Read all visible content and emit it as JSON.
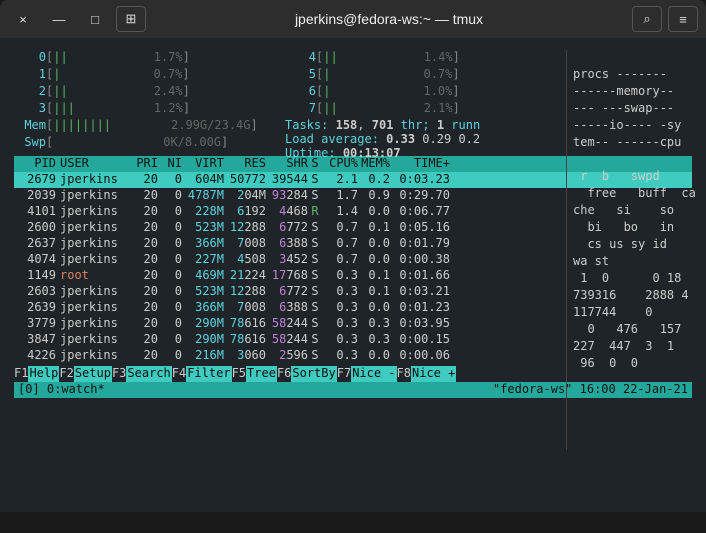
{
  "titlebar": {
    "close": "×",
    "minimize": "—",
    "maximize": "□",
    "new_tab": "⊞",
    "title": "jperkins@fedora-ws:~ — tmux",
    "search": "⌕",
    "menu": "≡"
  },
  "cpu_meters": [
    {
      "label": "0",
      "bars": "||",
      "val": "1.7%"
    },
    {
      "label": "1",
      "bars": "|",
      "val": "0.7%"
    },
    {
      "label": "2",
      "bars": "||",
      "val": "2.4%"
    },
    {
      "label": "3",
      "bars": "|||",
      "val": "1.2%"
    },
    {
      "label": "4",
      "bars": "||",
      "val": "1.4%"
    },
    {
      "label": "5",
      "bars": "|",
      "val": "0.7%"
    },
    {
      "label": "6",
      "bars": "|",
      "val": "1.0%"
    },
    {
      "label": "7",
      "bars": "||",
      "val": "2.1%"
    }
  ],
  "mem": {
    "label": "Mem",
    "bars": "||||||||",
    "val": "2.99G/23.4G"
  },
  "swp": {
    "label": "Swp",
    "bars": "",
    "val": "0K/8.00G"
  },
  "tasks": {
    "label": "Tasks:",
    "procs": "158",
    "sep": ",",
    "thr": "701",
    "thr_lbl": "thr;",
    "run": "1",
    "run_lbl": "runn"
  },
  "load": {
    "label": "Load average:",
    "v1": "0.33",
    "v2": "0.29",
    "v3": "0.2"
  },
  "uptime": {
    "label": "Uptime:",
    "val": "00:13:07"
  },
  "right_panel": [
    "",
    "procs -------",
    "------memory--",
    "--- ---swap---",
    "-----io---- -sy",
    "tem-- ------cpu",
    "",
    " r  b   swpd",
    "  free   buff  ca",
    "che   si    so",
    "  bi   bo   in",
    "  cs us sy id",
    "wa st",
    " 1  0      0 18",
    "739316    2888 4",
    "117744    0",
    "  0   476   157",
    "227  447  3  1",
    " 96  0  0"
  ],
  "proc_header": {
    "pid": "PID",
    "user": "USER",
    "pri": "PRI",
    "ni": "NI",
    "virt": "VIRT",
    "res": "RES",
    "shr": "SHR",
    "s": "S",
    "cpu": "CPU%",
    "mem": "MEM%",
    "time": "TIME+"
  },
  "procs": [
    {
      "pid": "2679",
      "user": "jperkins",
      "pri": "20",
      "ni": "0",
      "virt": "604M",
      "res": "50772",
      "shr": "39544",
      "s": "S",
      "cpu": "2.1",
      "mem": "0.2",
      "time": "0:03.23",
      "sel": true
    },
    {
      "pid": "2039",
      "user": "jperkins",
      "pri": "20",
      "ni": "0",
      "virt": "4787M",
      "res": "204M",
      "shr": "93284",
      "s": "S",
      "cpu": "1.7",
      "mem": "0.9",
      "time": "0:29.70"
    },
    {
      "pid": "4101",
      "user": "jperkins",
      "pri": "20",
      "ni": "0",
      "virt": "228M",
      "res": "6192",
      "shr": "4468",
      "s": "R",
      "cpu": "1.4",
      "mem": "0.0",
      "time": "0:06.77"
    },
    {
      "pid": "2600",
      "user": "jperkins",
      "pri": "20",
      "ni": "0",
      "virt": "523M",
      "res": "12288",
      "shr": "6772",
      "s": "S",
      "cpu": "0.7",
      "mem": "0.1",
      "time": "0:05.16"
    },
    {
      "pid": "2637",
      "user": "jperkins",
      "pri": "20",
      "ni": "0",
      "virt": "366M",
      "res": "7008",
      "shr": "6388",
      "s": "S",
      "cpu": "0.7",
      "mem": "0.0",
      "time": "0:01.79"
    },
    {
      "pid": "4074",
      "user": "jperkins",
      "pri": "20",
      "ni": "0",
      "virt": "227M",
      "res": "4508",
      "shr": "3452",
      "s": "S",
      "cpu": "0.7",
      "mem": "0.0",
      "time": "0:00.38"
    },
    {
      "pid": "1149",
      "user": "root",
      "pri": "20",
      "ni": "0",
      "virt": "469M",
      "res": "21224",
      "shr": "17768",
      "s": "S",
      "cpu": "0.3",
      "mem": "0.1",
      "time": "0:01.66",
      "root": true
    },
    {
      "pid": "2603",
      "user": "jperkins",
      "pri": "20",
      "ni": "0",
      "virt": "523M",
      "res": "12288",
      "shr": "6772",
      "s": "S",
      "cpu": "0.3",
      "mem": "0.1",
      "time": "0:03.21"
    },
    {
      "pid": "2639",
      "user": "jperkins",
      "pri": "20",
      "ni": "0",
      "virt": "366M",
      "res": "7008",
      "shr": "6388",
      "s": "S",
      "cpu": "0.3",
      "mem": "0.0",
      "time": "0:01.23"
    },
    {
      "pid": "3779",
      "user": "jperkins",
      "pri": "20",
      "ni": "0",
      "virt": "290M",
      "res": "78616",
      "shr": "58244",
      "s": "S",
      "cpu": "0.3",
      "mem": "0.3",
      "time": "0:03.95"
    },
    {
      "pid": "3847",
      "user": "jperkins",
      "pri": "20",
      "ni": "0",
      "virt": "290M",
      "res": "78616",
      "shr": "58244",
      "s": "S",
      "cpu": "0.3",
      "mem": "0.3",
      "time": "0:00.15"
    },
    {
      "pid": "4226",
      "user": "jperkins",
      "pri": "20",
      "ni": "0",
      "virt": "216M",
      "res": "3060",
      "shr": "2596",
      "s": "S",
      "cpu": "0.3",
      "mem": "0.0",
      "time": "0:00.06"
    }
  ],
  "fkeys": [
    {
      "k": "F1",
      "l": "Help"
    },
    {
      "k": "F2",
      "l": "Setup"
    },
    {
      "k": "F3",
      "l": "Search"
    },
    {
      "k": "F4",
      "l": "Filter"
    },
    {
      "k": "F5",
      "l": "Tree"
    },
    {
      "k": "F6",
      "l": "SortBy"
    },
    {
      "k": "F7",
      "l": "Nice -"
    },
    {
      "k": "F8",
      "l": "Nice +"
    }
  ],
  "tmux": {
    "left": "[0] 0:watch*",
    "right": "\"fedora-ws\" 16:00 22-Jan-21"
  }
}
